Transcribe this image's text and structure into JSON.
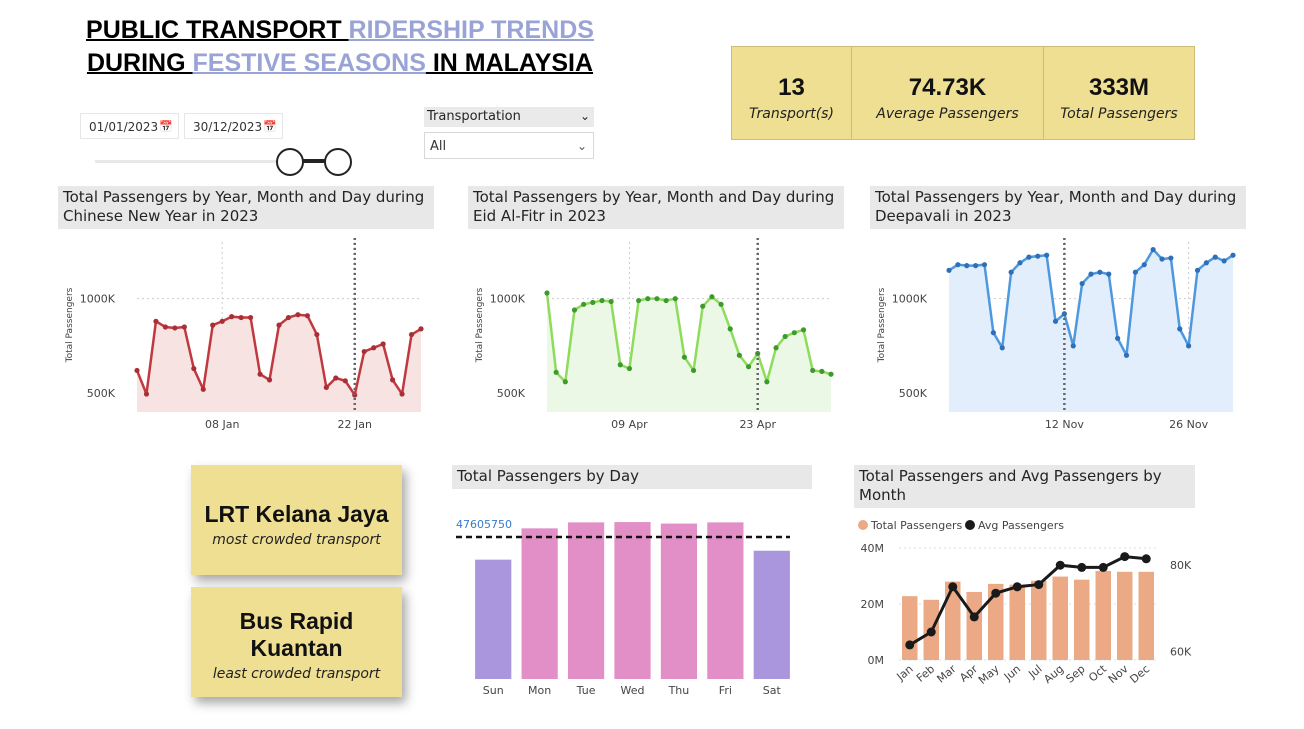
{
  "title": {
    "p1": "PUBLIC TRANSPORT ",
    "p2": "RIDERSHIP TRENDS",
    "p3": "DURING ",
    "p4": "FESTIVE SEASONS",
    "p5": " IN MALAYSIA"
  },
  "filters": {
    "start_date": "01/01/2023",
    "end_date": "30/12/2023",
    "calendar_icon": "calendar-icon",
    "transport_label": "Transportation",
    "transport_value": "All",
    "slider_fill": 1.0
  },
  "kpis": [
    {
      "value": "13",
      "label": "Transport(s)"
    },
    {
      "value": "74.73K",
      "label": "Average Passengers"
    },
    {
      "value": "333M",
      "label": "Total Passengers"
    }
  ],
  "colors": {
    "kpi_bg": "#efdf92",
    "cny_line": "#c0393f",
    "cny_fill": "#f8e3e3",
    "eid_line": "#8ddc5a",
    "eid_fill": "#ecf8e6",
    "deep_line": "#4e98e0",
    "deep_fill": "#e2eefb",
    "weekend_bar": "#a996dc",
    "weekday_bar": "#e28fc8",
    "month_bar": "#eba985",
    "avg_line": "#1a1a1a",
    "title_accent": "#9aa3d6"
  },
  "cards": [
    {
      "name": "LRT Kelana Jaya",
      "subtitle": "most crowded transport"
    },
    {
      "name": "Bus Rapid Kuantan",
      "subtitle": "least crowded transport"
    }
  ],
  "chart_data": [
    {
      "type": "line",
      "title": "Total Passengers by Year, Month and Day during Chinese New Year in 2023",
      "ylabel": "Total Passengers",
      "yticks": [
        "1000K",
        "500K"
      ],
      "ytick_values": [
        1000,
        500
      ],
      "ylim": [
        400,
        1300
      ],
      "xticks": [
        "08 Jan",
        "22 Jan"
      ],
      "xtick_index": [
        9,
        23
      ],
      "marker_index": 23,
      "series": [
        {
          "values": [
            620,
            495,
            880,
            850,
            845,
            850,
            630,
            520,
            860,
            880,
            905,
            900,
            900,
            600,
            570,
            860,
            900,
            915,
            910,
            810,
            530,
            580,
            565,
            490,
            720,
            740,
            760,
            570,
            495,
            810,
            840
          ]
        }
      ]
    },
    {
      "type": "line",
      "title": "Total Passengers by Year, Month and Day during Eid Al-Fitr in 2023",
      "ylabel": "Total Passengers",
      "yticks": [
        "1000K",
        "500K"
      ],
      "ytick_values": [
        1000,
        500
      ],
      "ylim": [
        400,
        1300
      ],
      "xticks": [
        "09 Apr",
        "23 Apr"
      ],
      "xtick_index": [
        9,
        23
      ],
      "marker_index": 23,
      "series": [
        {
          "values": [
            1030,
            610,
            560,
            940,
            970,
            980,
            990,
            985,
            650,
            630,
            990,
            1000,
            1000,
            990,
            1000,
            690,
            620,
            960,
            1010,
            970,
            840,
            700,
            640,
            710,
            560,
            740,
            800,
            820,
            835,
            620,
            615,
            600
          ]
        }
      ]
    },
    {
      "type": "line",
      "title": "Total Passengers by Year, Month and Day during Deepavali in 2023",
      "ylabel": "Total Passengers",
      "yticks": [
        "1000K",
        "500K"
      ],
      "ytick_values": [
        1000,
        500
      ],
      "ylim": [
        400,
        1300
      ],
      "xticks": [
        "12 Nov",
        "26 Nov"
      ],
      "xtick_index": [
        13,
        27
      ],
      "marker_index": 13,
      "series": [
        {
          "values": [
            1150,
            1180,
            1175,
            1175,
            1180,
            820,
            740,
            1140,
            1190,
            1220,
            1225,
            1230,
            880,
            920,
            750,
            1080,
            1130,
            1140,
            1130,
            790,
            700,
            1140,
            1180,
            1260,
            1210,
            1215,
            840,
            750,
            1150,
            1190,
            1220,
            1200,
            1230
          ]
        }
      ]
    },
    {
      "type": "bar",
      "title": "Total Passengers by Day",
      "categories": [
        "Sun",
        "Mon",
        "Tue",
        "Wed",
        "Thu",
        "Fri",
        "Sat"
      ],
      "values": [
        40000000,
        50500000,
        52500000,
        52600000,
        52100000,
        52500000,
        43000000
      ],
      "reference_line": 47605750,
      "reference_label": "47605750",
      "ylim": [
        0,
        60000000
      ]
    },
    {
      "type": "bar",
      "title": "Total Passengers and Avg Passengers by Month",
      "categories": [
        "Jan",
        "Feb",
        "Mar",
        "Apr",
        "May",
        "Jun",
        "Jul",
        "Aug",
        "Sep",
        "Oct",
        "Nov",
        "Dec"
      ],
      "yticks_left": [
        "40M",
        "20M",
        "0M"
      ],
      "yticks_right": [
        "80K",
        "60K"
      ],
      "legend": [
        "Total Passengers",
        "Avg Passengers"
      ],
      "legend_position": "top-left",
      "series": [
        {
          "name": "Total Passengers",
          "type": "bar",
          "values": [
            22800000,
            21500000,
            28000000,
            24300000,
            27200000,
            26900000,
            28300000,
            29800000,
            28700000,
            31800000,
            31500000,
            31500000
          ],
          "ylim": [
            0,
            40000000
          ]
        },
        {
          "name": "Avg Passengers",
          "type": "line",
          "values": [
            61500,
            64500,
            75000,
            68000,
            73500,
            75000,
            75500,
            80000,
            79500,
            79500,
            82000,
            81500
          ],
          "ylim": [
            58000,
            84000
          ]
        }
      ]
    }
  ]
}
